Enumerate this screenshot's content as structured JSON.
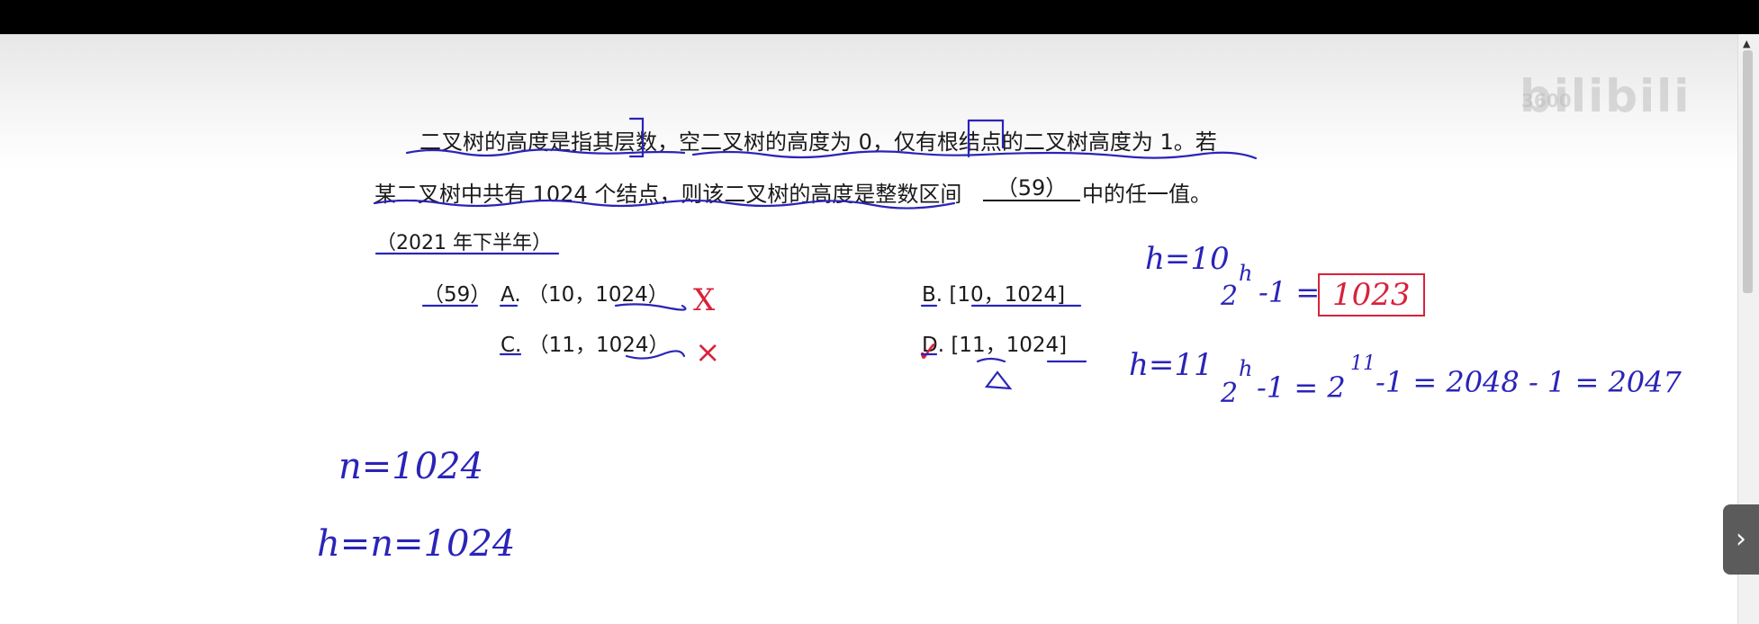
{
  "watermark": {
    "brand": "bilibili",
    "small": "3600"
  },
  "question": {
    "line1": "二叉树的高度是指其层数，空二叉树的高度为 0，仅有根结点的二叉树高度为 1。若",
    "line2a": "某二叉树中共有 1024 个结点，则该二叉树的高度是整数区间",
    "blank": "（59）",
    "line2b": "中的任一值。",
    "source": "（2021 年下半年）"
  },
  "options": {
    "num": "（59）",
    "a": "A. （10，1024）",
    "b": "B. [10，1024]",
    "c": "C. （11，1024）",
    "d": "D. [11，1024]"
  },
  "handwriting": {
    "h10": "h=10",
    "eq1": "2",
    "eq1_exp": "h",
    "eq1_rest": "-1 = ",
    "box": "1023",
    "h11": "h=11",
    "eq2": "2",
    "eq2_exp": "h",
    "eq2_mid": "-1 = 2",
    "eq2_exp2": "11",
    "eq2_rest": "-1 = 2048 - 1 = 2047",
    "n1": "n=1024",
    "n2": "h=n=1024",
    "mark_a": "X",
    "mark_c": "×",
    "mark_d": "✓"
  },
  "side_button_icon": "chevron-right-icon",
  "colors": {
    "ink_blue": "#2a24b8",
    "ink_red": "#d8223a"
  }
}
